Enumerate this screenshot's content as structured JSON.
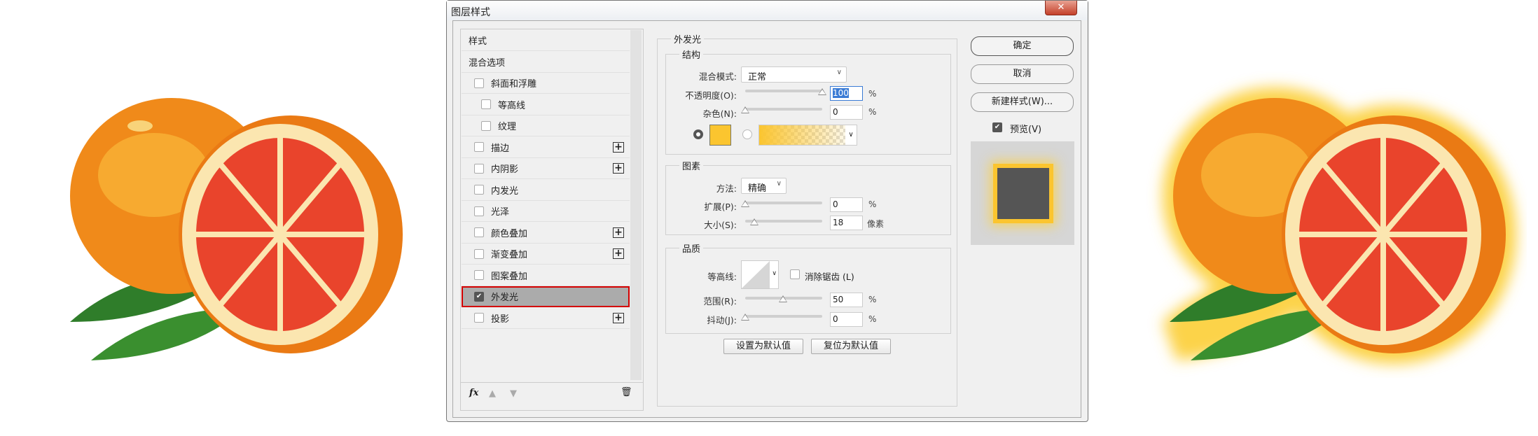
{
  "dialog": {
    "title": "图层样式",
    "close": "✕"
  },
  "styles_panel": {
    "items": [
      {
        "label": "样式",
        "checkbox": false
      },
      {
        "label": "混合选项",
        "checkbox": false
      },
      {
        "label": "斜面和浮雕",
        "checkbox": true,
        "checked": false
      },
      {
        "label": "等高线",
        "checkbox": true,
        "checked": false,
        "indent": true
      },
      {
        "label": "纹理",
        "checkbox": true,
        "checked": false,
        "indent": true
      },
      {
        "label": "描边",
        "checkbox": true,
        "checked": false,
        "plus": true
      },
      {
        "label": "内阴影",
        "checkbox": true,
        "checked": false,
        "plus": true
      },
      {
        "label": "内发光",
        "checkbox": true,
        "checked": false
      },
      {
        "label": "光泽",
        "checkbox": true,
        "checked": false
      },
      {
        "label": "颜色叠加",
        "checkbox": true,
        "checked": false,
        "plus": true
      },
      {
        "label": "渐变叠加",
        "checkbox": true,
        "checked": false,
        "plus": true
      },
      {
        "label": "图案叠加",
        "checkbox": true,
        "checked": false
      },
      {
        "label": "外发光",
        "checkbox": true,
        "checked": true,
        "selected": true
      },
      {
        "label": "投影",
        "checkbox": true,
        "checked": false,
        "plus": true
      }
    ],
    "toolbar": {
      "fx": "fx",
      "up": "▲",
      "down": "▼",
      "delete": "🗑"
    }
  },
  "outer_glow": {
    "title": "外发光",
    "structure": {
      "title": "结构",
      "blend_mode_label": "混合模式:",
      "blend_mode": "正常",
      "opacity_label": "不透明度(O):",
      "opacity": "100",
      "opacity_unit": "%",
      "noise_label": "杂色(N):",
      "noise": "0",
      "noise_unit": "%",
      "color": "#fbc52f"
    },
    "elements": {
      "title": "图素",
      "method_label": "方法:",
      "method": "精确",
      "spread_label": "扩展(P):",
      "spread": "0",
      "spread_unit": "%",
      "size_label": "大小(S):",
      "size": "18",
      "size_unit": "像素"
    },
    "quality": {
      "title": "品质",
      "contour_label": "等高线:",
      "antialias_label": "消除锯齿 (L)",
      "range_label": "范围(R):",
      "range": "50",
      "range_unit": "%",
      "jitter_label": "抖动(J):",
      "jitter": "0",
      "jitter_unit": "%"
    },
    "set_default": "设置为默认值",
    "reset_default": "复位为默认值"
  },
  "actions": {
    "ok": "确定",
    "cancel": "取消",
    "new_style": "新建样式(W)...",
    "preview_label": "预览(V)",
    "preview_checked": true
  }
}
